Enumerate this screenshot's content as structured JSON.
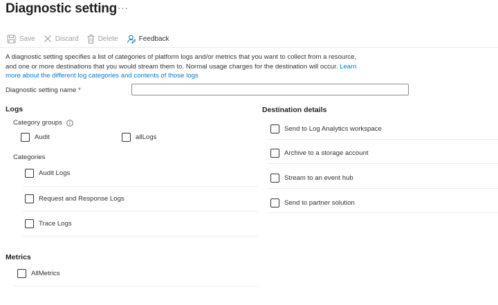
{
  "page": {
    "title": "Diagnostic setting",
    "more": "···"
  },
  "toolbar": {
    "save": "Save",
    "discard": "Discard",
    "delete": "Delete",
    "feedback": "Feedback"
  },
  "description": {
    "text": "A diagnostic setting specifies a list of categories of platform logs and/or metrics that you want to collect from a resource, and one or more destinations that you would stream them to. Normal usage charges for the destination will occur. ",
    "link": "Learn more about the different log categories and contents of those logs"
  },
  "form": {
    "name_label": "Diagnostic setting name",
    "required_mark": "*",
    "name_value": ""
  },
  "logs": {
    "heading": "Logs",
    "category_groups_label": "Category groups",
    "category_groups": [
      {
        "label": "Audit",
        "checked": false
      },
      {
        "label": "allLogs",
        "checked": false
      }
    ],
    "categories_label": "Categories",
    "categories": [
      {
        "label": "Audit Logs",
        "checked": false
      },
      {
        "label": "Request and Response Logs",
        "checked": false
      },
      {
        "label": "Trace Logs",
        "checked": false
      }
    ]
  },
  "metrics": {
    "heading": "Metrics",
    "items": [
      {
        "label": "AllMetrics",
        "checked": false
      }
    ]
  },
  "destination": {
    "heading": "Destination details",
    "items": [
      {
        "label": "Send to Log Analytics workspace",
        "checked": false
      },
      {
        "label": "Archive to a storage account",
        "checked": false
      },
      {
        "label": "Stream to an event hub",
        "checked": false
      },
      {
        "label": "Send to partner solution",
        "checked": false
      }
    ]
  },
  "colors": {
    "link": "#0078d4",
    "required": "#a4262c",
    "disabled": "#a19f9d",
    "text": "#323130"
  }
}
